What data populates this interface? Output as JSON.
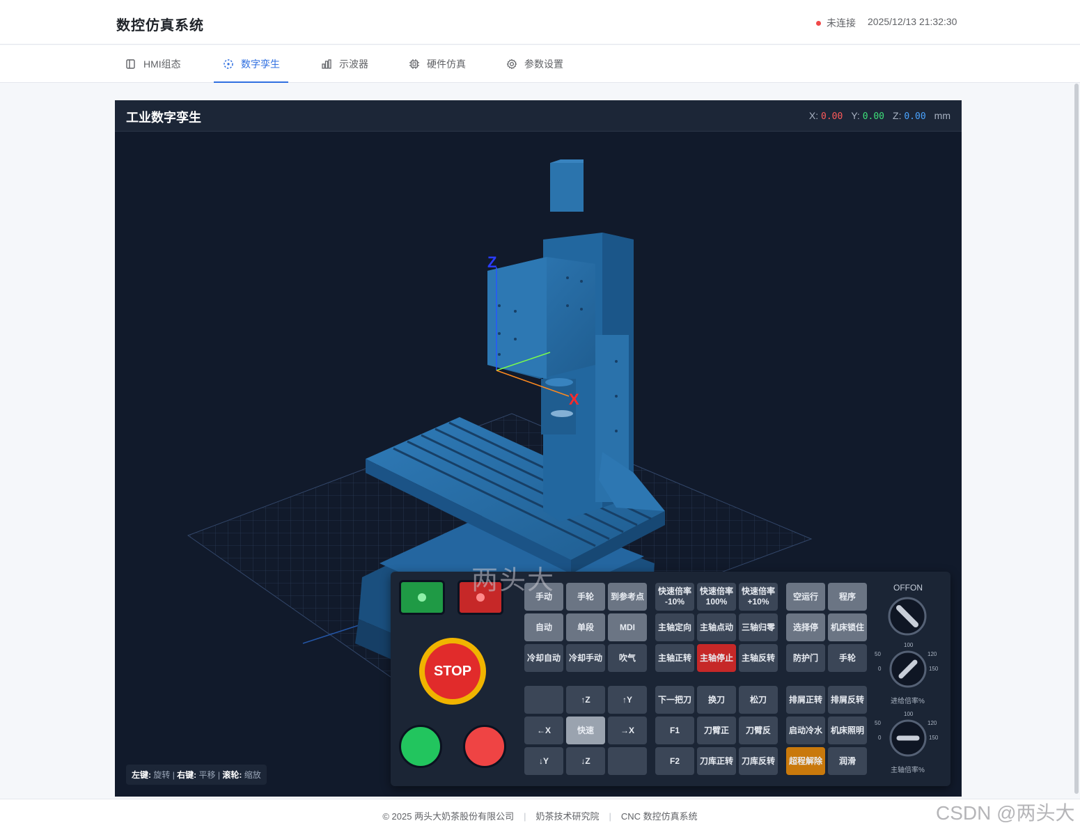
{
  "header": {
    "title": "数控仿真系统",
    "status": "未连接",
    "datetime": "2025/12/13 21:32:30"
  },
  "tabs": [
    {
      "label": "HMI组态",
      "icon": "layout-icon"
    },
    {
      "label": "数字孪生",
      "icon": "twin-icon",
      "active": true
    },
    {
      "label": "示波器",
      "icon": "bar-chart-icon"
    },
    {
      "label": "硬件仿真",
      "icon": "chip-icon"
    },
    {
      "label": "参数设置",
      "icon": "gear-icon"
    }
  ],
  "twin": {
    "title": "工业数字孪生",
    "coords": {
      "x_label": "X:",
      "x": "0.00",
      "y_label": "Y:",
      "y": "0.00",
      "z_label": "Z:",
      "z": "0.00",
      "unit": "mm"
    },
    "axis_x": "X",
    "axis_z": "Z",
    "hint": {
      "left_key": "左键:",
      "left_action": "旋转",
      "sep1": "|",
      "right_key": "右键:",
      "right_action": "平移",
      "sep2": "|",
      "wheel_key": "滚轮:",
      "wheel_action": "缩放"
    },
    "watermark": "两头大"
  },
  "panel": {
    "stop_label": "STOP",
    "keys_a": [
      [
        "手动",
        "手轮",
        "到参考点"
      ],
      [
        "自动",
        "单段",
        "MDI"
      ],
      [
        "冷却自动",
        "冷却手动",
        "吹气"
      ]
    ],
    "keys_b": [
      [
        "快速倍率\n-10%",
        "快速倍率\n100%",
        "快速倍率\n+10%"
      ],
      [
        "主轴定向",
        "主轴点动",
        "三轴归零"
      ],
      [
        "主轴正转",
        "主轴停止",
        "主轴反转"
      ]
    ],
    "keys_c": [
      [
        "空运行",
        "程序"
      ],
      [
        "选择停",
        "机床锁住"
      ],
      [
        "防护门",
        "手轮"
      ]
    ],
    "keys_d": [
      [
        "",
        "↑Z",
        "↑Y"
      ],
      [
        "←X",
        "快速",
        "→X"
      ],
      [
        "↓Y",
        "↓Z",
        ""
      ]
    ],
    "keys_e": [
      [
        "下一把刀",
        "换刀",
        "松刀"
      ],
      [
        "F1",
        "刀臂正",
        "刀臂反"
      ],
      [
        "F2",
        "刀库正转",
        "刀库反转"
      ]
    ],
    "keys_f": [
      [
        "排屑正转",
        "排屑反转"
      ],
      [
        "启动冷水",
        "机床照明"
      ],
      [
        "超程解除",
        "润滑"
      ]
    ],
    "offon": "OFFON",
    "feed_dial": {
      "label": "进给倍率%",
      "nums": [
        "100",
        "50",
        "120",
        "0",
        "150"
      ]
    },
    "spindle_dial": {
      "label": "主轴倍率%",
      "nums": [
        "100",
        "50",
        "120",
        "0",
        "150"
      ]
    }
  },
  "footer": {
    "copyright": "© 2025 两头大奶茶股份有限公司",
    "sep": "|",
    "institute": "奶茶技术研究院",
    "system": "CNC 数控仿真系统"
  },
  "overlay": {
    "csdn": "CSDN @两头大"
  },
  "colors": {
    "accent": "#2f6fe0",
    "status_red": "#f04848",
    "panel_bg": "#1b2535",
    "machine_blue": "#2a6fa8"
  }
}
